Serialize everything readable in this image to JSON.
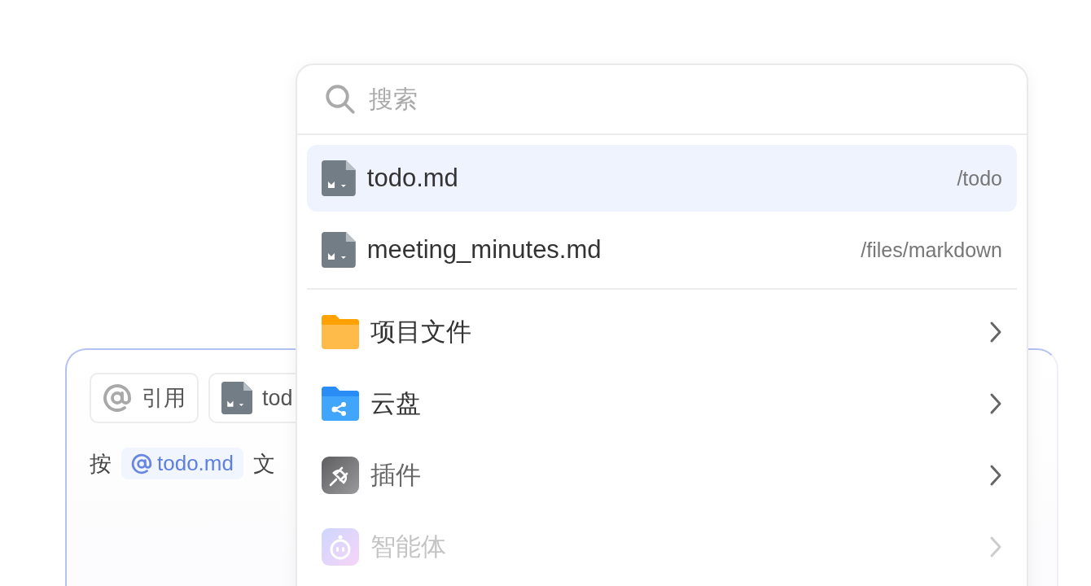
{
  "editor": {
    "chips": [
      {
        "kind": "mention",
        "label": "引用"
      },
      {
        "kind": "file",
        "label": "tod"
      }
    ],
    "text": [
      {
        "kind": "plain",
        "text": "按"
      },
      {
        "kind": "mention",
        "text": "todo.md"
      },
      {
        "kind": "plain",
        "text": "文"
      }
    ]
  },
  "popup": {
    "search": {
      "placeholder": "搜索"
    },
    "files": [
      {
        "name": "todo.md",
        "path": "/todo",
        "selected": true
      },
      {
        "name": "meeting_minutes.md",
        "path": "/files/markdown",
        "selected": false
      }
    ],
    "categories": [
      {
        "kind": "folder",
        "label": "项目文件"
      },
      {
        "kind": "cloud",
        "label": "云盘"
      },
      {
        "kind": "plugin",
        "label": "插件"
      },
      {
        "kind": "agent",
        "label": "智能体"
      }
    ]
  }
}
